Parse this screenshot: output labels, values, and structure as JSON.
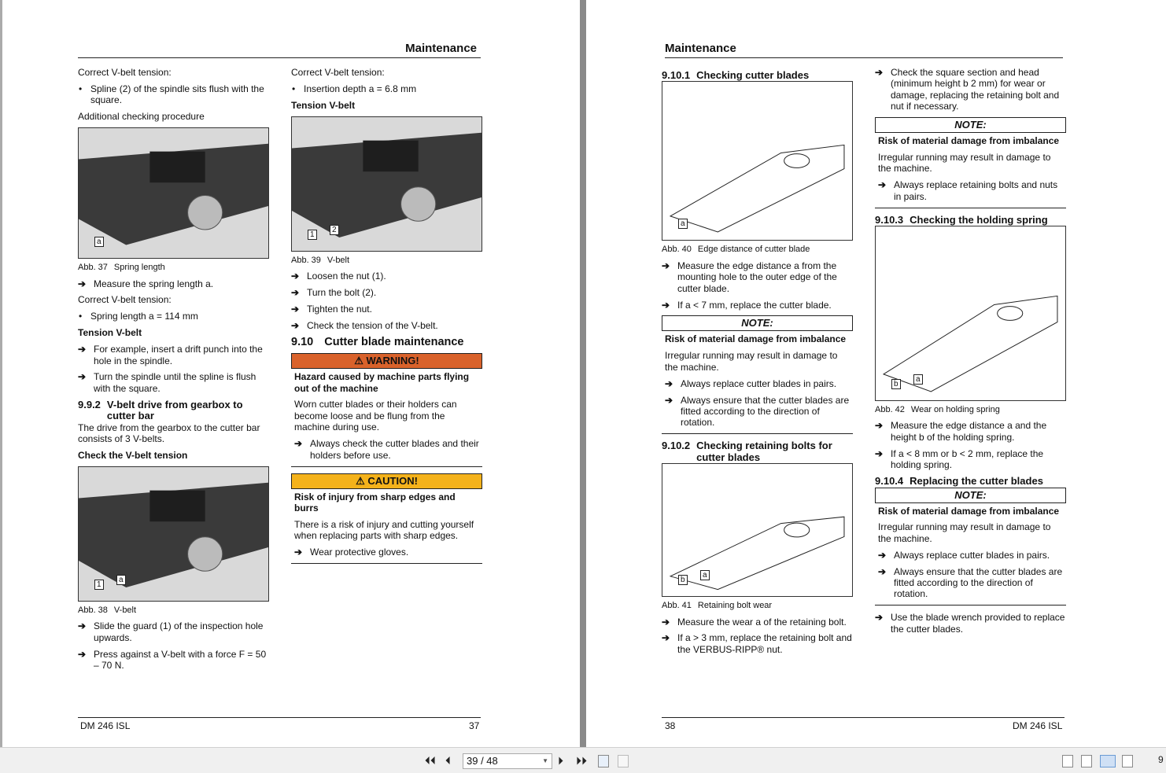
{
  "viewer": {
    "page_input": "39 / 48",
    "zoom_partial": "9",
    "icons": [
      "first-page-icon",
      "previous-page-icon",
      "next-page-icon",
      "last-page-icon",
      "continuous-facing-icon",
      "facing-icon"
    ]
  },
  "colors": {
    "warning": "#d9622b",
    "caution": "#f4b21b"
  },
  "left_page": {
    "header": "Maintenance",
    "footer_left": "DM 246 ISL",
    "footer_right": "37",
    "columns": [
      [
        {
          "t": "p",
          "text": "Correct V-belt tension:"
        },
        {
          "t": "bullet",
          "text": "Spline (2) of the spindle sits flush with the square."
        },
        {
          "t": "p",
          "text": "Additional checking procedure"
        },
        {
          "t": "fig",
          "id": "37",
          "abb": "Abb. 37",
          "caption": "Spring length",
          "labels": [
            "a"
          ]
        },
        {
          "t": "arrow",
          "text": "Measure the spring length a."
        },
        {
          "t": "p",
          "text": "Correct V-belt tension:"
        },
        {
          "t": "bullet",
          "text": "Spring length a = 114 mm"
        },
        {
          "t": "bold",
          "text": "Tension V-belt"
        },
        {
          "t": "arrow",
          "text": "For example, insert a drift punch into the hole in the spindle."
        },
        {
          "t": "arrow",
          "text": "Turn the spindle until the spline is flush with the square."
        },
        {
          "t": "h3",
          "num": "9.9.2",
          "text": "V-belt drive from gearbox to cutter bar"
        },
        {
          "t": "p",
          "text": "The drive from the gearbox to the cutter bar consists of 3 V-belts."
        },
        {
          "t": "bold",
          "text": "Check the V-belt tension"
        },
        {
          "t": "fig",
          "id": "38",
          "abb": "Abb. 38",
          "caption": "V-belt",
          "labels": [
            "1",
            "a"
          ]
        },
        {
          "t": "arrow",
          "text": "Slide the guard (1) of the inspection hole upwards."
        },
        {
          "t": "arrow",
          "text": "Press against a V-belt with a force F = 50 – 70 N."
        }
      ],
      [
        {
          "t": "p",
          "text": "Correct V-belt tension:"
        },
        {
          "t": "bullet",
          "text": "Insertion depth a = 6.8 mm"
        },
        {
          "t": "bold",
          "text": "Tension V-belt"
        },
        {
          "t": "fig",
          "id": "39",
          "abb": "Abb. 39",
          "caption": "V-belt",
          "labels": [
            "1",
            "2"
          ]
        },
        {
          "t": "arrow",
          "text": "Loosen the nut (1)."
        },
        {
          "t": "arrow",
          "text": "Turn the bolt (2)."
        },
        {
          "t": "arrow",
          "text": "Tighten the nut."
        },
        {
          "t": "arrow",
          "text": "Check the tension of the V-belt."
        },
        {
          "t": "h2",
          "num": "9.10",
          "text": "Cutter blade maintenance"
        },
        {
          "t": "box",
          "kind": "warning",
          "title": "⚠ WARNING!",
          "heading": "Hazard caused by machine parts flying out of the machine",
          "text": "Worn cutter blades or their holders can become loose and be flung from the machine during use.",
          "arrows": [
            "Always check the cutter blades and their holders before use."
          ]
        },
        {
          "t": "box",
          "kind": "caution",
          "title": "⚠ CAUTION!",
          "heading": "Risk of injury from sharp edges and burrs",
          "text": "There is a risk of injury and cutting yourself when replacing parts with sharp edges.",
          "arrows": [
            "Wear protective gloves."
          ]
        }
      ]
    ]
  },
  "right_page": {
    "header": "Maintenance",
    "footer_left": "38",
    "footer_right": "DM 246 ISL",
    "columns": [
      [
        {
          "t": "h3",
          "num": "9.10.1",
          "text": "Checking cutter blades"
        },
        {
          "t": "fig",
          "id": "40",
          "abb": "Abb. 40",
          "caption": "Edge distance of cutter blade",
          "labels": [
            "a"
          ]
        },
        {
          "t": "arrow",
          "text": "Measure the edge distance a from the mounting hole to the outer edge of the cutter blade."
        },
        {
          "t": "arrow",
          "text": "If a < 7 mm, replace the cutter blade."
        },
        {
          "t": "box",
          "kind": "note",
          "title": "NOTE:",
          "heading": "Risk of material damage from imbalance",
          "text": "Irregular running may result in damage to the machine.",
          "arrows": [
            "Always replace cutter blades in pairs.",
            "Always ensure that the cutter blades are fitted according to the direction of rotation."
          ]
        },
        {
          "t": "h3",
          "num": "9.10.2",
          "text": "Checking retaining bolts for cutter blades"
        },
        {
          "t": "fig",
          "id": "41",
          "abb": "Abb. 41",
          "caption": "Retaining bolt wear",
          "labels": [
            "b",
            "a"
          ]
        },
        {
          "t": "arrow",
          "text": "Measure the wear a of the retaining bolt."
        },
        {
          "t": "arrow",
          "text": "If a > 3 mm, replace the retaining bolt and the VERBUS-RIPP® nut."
        }
      ],
      [
        {
          "t": "arrow",
          "text": "Check the square section and head (minimum height b 2 mm) for wear or damage, replacing the retaining bolt and nut if necessary."
        },
        {
          "t": "box",
          "kind": "note",
          "title": "NOTE:",
          "heading": "Risk of material damage from imbalance",
          "text": "Irregular running may result in damage to the machine.",
          "arrows": [
            "Always replace retaining bolts and nuts in pairs."
          ]
        },
        {
          "t": "h3",
          "num": "9.10.3",
          "text": "Checking the holding spring"
        },
        {
          "t": "fig",
          "id": "42",
          "abb": "Abb. 42",
          "caption": "Wear on holding spring",
          "labels": [
            "b",
            "a"
          ]
        },
        {
          "t": "arrow",
          "text": "Measure the edge distance a and the height b of the holding spring."
        },
        {
          "t": "arrow",
          "text": "If a < 8 mm or b < 2 mm, replace the holding spring."
        },
        {
          "t": "h3",
          "num": "9.10.4",
          "text": "Replacing the cutter blades"
        },
        {
          "t": "box",
          "kind": "note",
          "title": "NOTE:",
          "heading": "Risk of material damage from imbalance",
          "text": "Irregular running may result in damage to the machine.",
          "arrows": [
            "Always replace cutter blades in pairs.",
            "Always ensure that the cutter blades are fitted according to the direction of rotation."
          ]
        },
        {
          "t": "arrow",
          "text": "Use the blade wrench provided to replace the cutter blades."
        }
      ]
    ]
  }
}
